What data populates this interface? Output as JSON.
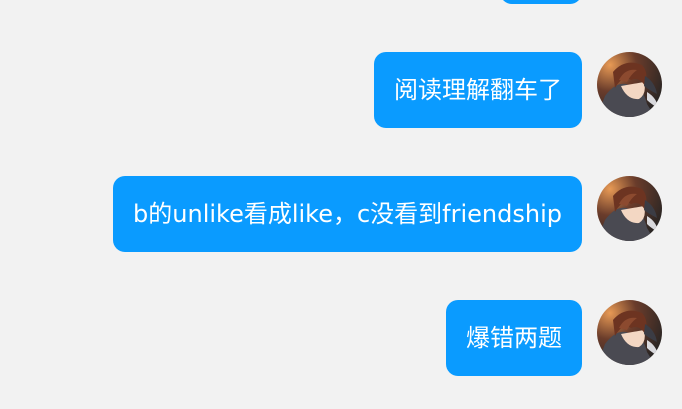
{
  "chat": {
    "messages": [
      {
        "text": "阅读理解翻车了",
        "avatar": "user-avatar"
      },
      {
        "text": "b的unlike看成like，c没看到friendship",
        "avatar": "user-avatar"
      },
      {
        "text": "爆错两题",
        "avatar": "user-avatar"
      }
    ]
  },
  "colors": {
    "background": "#f2f2f2",
    "bubble": "#0a9bff",
    "bubble_text": "#ffffff"
  }
}
